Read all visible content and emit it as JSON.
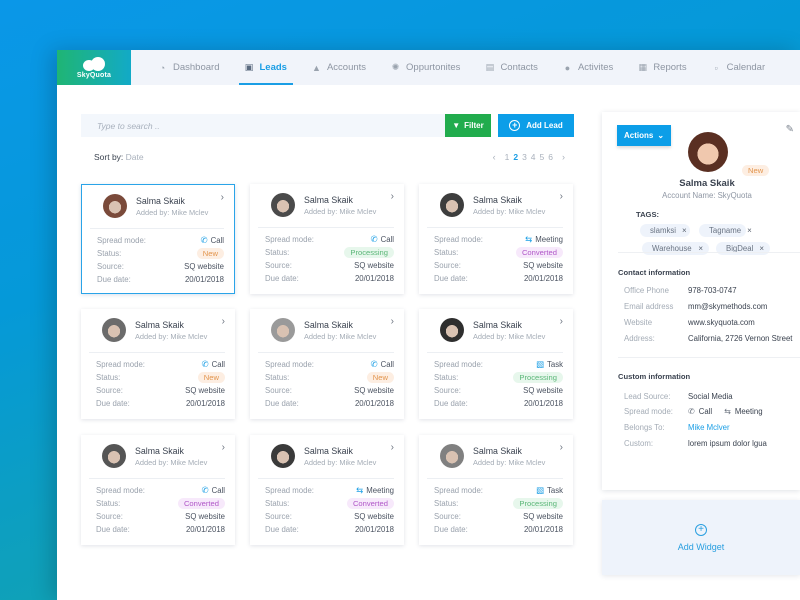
{
  "app": {
    "logo_text": "SkyQuota"
  },
  "nav": {
    "items": [
      {
        "label": "Dashboard",
        "icon": "dashboard-icon",
        "glyph": "◔",
        "active": false
      },
      {
        "label": "Leads",
        "icon": "leads-icon",
        "glyph": "▣",
        "active": true
      },
      {
        "label": "Accounts",
        "icon": "accounts-icon",
        "glyph": "▲",
        "active": false
      },
      {
        "label": "Oppurtonites",
        "icon": "opportunities-icon",
        "glyph": "✺",
        "active": false
      },
      {
        "label": "Contacts",
        "icon": "contacts-icon",
        "glyph": "▤",
        "active": false
      },
      {
        "label": "Activites",
        "icon": "activities-icon",
        "glyph": "●",
        "active": false
      },
      {
        "label": "Reports",
        "icon": "reports-icon",
        "glyph": "▦",
        "active": false
      },
      {
        "label": "Calendar",
        "icon": "calendar-icon",
        "glyph": "▫",
        "active": false
      }
    ]
  },
  "toolbar": {
    "search_placeholder": "Type to search ..",
    "filter_label": "Filter",
    "add_lead_label": "Add Lead",
    "sort_label": "Sort by:",
    "sort_value": "Date"
  },
  "pagination": {
    "pages": [
      "1",
      "2",
      "3",
      "4",
      "5",
      "6"
    ],
    "current": "2",
    "prev": "‹",
    "next": "›"
  },
  "leads": [
    {
      "name": "Salma Skaik",
      "added_by": "Added by: Mike Mclev",
      "spread_label": "Spread mode:",
      "spread": "Call",
      "mode_glyph": "✆",
      "status_label": "Status:",
      "status": "New",
      "status_type": "new",
      "source_label": "Source:",
      "source": "SQ website",
      "due_label": "Due date:",
      "due": "20/01/2018",
      "selected": true,
      "avatar_color": "#7a4a3a"
    },
    {
      "name": "Salma Skaik",
      "added_by": "Added by: Mike Mclev",
      "spread_label": "Spread mode:",
      "spread": "Call",
      "mode_glyph": "✆",
      "status_label": "Status:",
      "status": "Processing",
      "status_type": "processing",
      "source_label": "Source:",
      "source": "SQ website",
      "due_label": "Due date:",
      "due": "20/01/2018",
      "selected": false,
      "avatar_color": "#4a4a4a"
    },
    {
      "name": "Salma Skaik",
      "added_by": "Added by: Mike Mclev",
      "spread_label": "Spread mode:",
      "spread": "Meeting",
      "mode_glyph": "⇆",
      "status_label": "Status:",
      "status": "Converted",
      "status_type": "converted",
      "source_label": "Source:",
      "source": "SQ website",
      "due_label": "Due date:",
      "due": "20/01/2018",
      "selected": false,
      "avatar_color": "#3d3d3d"
    },
    {
      "name": "Salma Skaik",
      "added_by": "Added by: Mike Mclev",
      "spread_label": "Spread mode:",
      "spread": "Call",
      "mode_glyph": "✆",
      "status_label": "Status:",
      "status": "New",
      "status_type": "new",
      "source_label": "Source:",
      "source": "SQ website",
      "due_label": "Due date:",
      "due": "20/01/2018",
      "selected": false,
      "avatar_color": "#6b6b6b"
    },
    {
      "name": "Salma Skaik",
      "added_by": "Added by: Mike Mclev",
      "spread_label": "Spread mode:",
      "spread": "Call",
      "mode_glyph": "✆",
      "status_label": "Status:",
      "status": "New",
      "status_type": "new",
      "source_label": "Source:",
      "source": "SQ website",
      "due_label": "Due date:",
      "due": "20/01/2018",
      "selected": false,
      "avatar_color": "#9a9a9a"
    },
    {
      "name": "Salma Skaik",
      "added_by": "Added by: Mike Mclev",
      "spread_label": "Spread mode:",
      "spread": "Task",
      "mode_glyph": "▧",
      "status_label": "Status:",
      "status": "Processing",
      "status_type": "processing",
      "source_label": "Source:",
      "source": "SQ website",
      "due_label": "Due date:",
      "due": "20/01/2018",
      "selected": false,
      "avatar_color": "#2e2e2e"
    },
    {
      "name": "Salma Skaik",
      "added_by": "Added by: Mike Mclev",
      "spread_label": "Spread mode:",
      "spread": "Call",
      "mode_glyph": "✆",
      "status_label": "Status:",
      "status": "Converted",
      "status_type": "converted",
      "source_label": "Source:",
      "source": "SQ website",
      "due_label": "Due date:",
      "due": "20/01/2018",
      "selected": false,
      "avatar_color": "#555555"
    },
    {
      "name": "Salma Skaik",
      "added_by": "Added by: Mike Mclev",
      "spread_label": "Spread mode:",
      "spread": "Meeting",
      "mode_glyph": "⇆",
      "status_label": "Status:",
      "status": "Converted",
      "status_type": "converted",
      "source_label": "Source:",
      "source": "SQ website",
      "due_label": "Due date:",
      "due": "20/01/2018",
      "selected": false,
      "avatar_color": "#3a3a3a"
    },
    {
      "name": "Salma Skaik",
      "added_by": "Added by: Mike Mclev",
      "spread_label": "Spread mode:",
      "spread": "Task",
      "mode_glyph": "▧",
      "status_label": "Status:",
      "status": "Processing",
      "status_type": "processing",
      "source_label": "Source:",
      "source": "SQ website",
      "due_label": "Due date:",
      "due": "20/01/2018",
      "selected": false,
      "avatar_color": "#808080"
    }
  ],
  "detail": {
    "actions_label": "Actions",
    "status": "New",
    "name": "Salma Skaik",
    "account": "Account Name: SkyQuota",
    "tags_label": "TAGS:",
    "tags": [
      "slamksi",
      "Tagname",
      "Warehouse",
      "BigDeal"
    ],
    "contact_title": "Contact information",
    "contact": [
      {
        "key": "Office Phone",
        "value": "978-703-0747"
      },
      {
        "key": "Email address",
        "value": "mm@skymethods.com"
      },
      {
        "key": "Website",
        "value": "www.skyquota.com"
      },
      {
        "key": "Address:",
        "value": "California, 2726 Vernon Street"
      }
    ],
    "custom_title": "Custom information",
    "custom": {
      "lead_source_key": "Lead Source:",
      "lead_source": "Social Media",
      "spread_key": "Spread mode:",
      "spread_call": "Call",
      "spread_meeting": "Meeting",
      "belongs_key": "Belongs To:",
      "belongs": "Mike Mclver",
      "custom_key": "Custom:",
      "custom": "lorem ipsum dolor lgua"
    }
  },
  "widget": {
    "label": "Add Widget"
  },
  "colors": {
    "accent": "#0c9ee8",
    "filter": "#21ac4d",
    "new": "#e2954e",
    "processing": "#5ab677",
    "converted": "#b057c8"
  }
}
